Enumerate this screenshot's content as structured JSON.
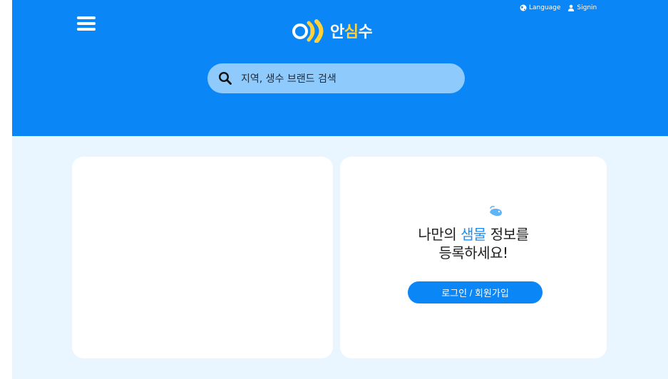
{
  "header": {
    "logo_text_prefix": "안",
    "logo_text_accent": "심",
    "logo_text_suffix": "수",
    "language_label": "Language",
    "signin_label": "Signin"
  },
  "search": {
    "placeholder": "지역, 생수 브랜드 검색"
  },
  "promo": {
    "line1_start": "나만의 ",
    "line1_highlight": "샘물",
    "line1_end": " 정보를",
    "line2": "등록하세요!",
    "button_label": "로그인 / 회원가입"
  },
  "colors": {
    "header_bg": "#0a86f7",
    "page_bg": "#eaf6ff",
    "search_bg": "#8fcafc",
    "accent_yellow": "#ffd13a",
    "highlight_blue": "#1f8ef2"
  },
  "icons": {
    "menu": "hamburger-menu-icon",
    "language": "globe-icon",
    "signin": "user-icon",
    "search": "magnifier-icon",
    "droplet": "water-droplet-icon"
  }
}
